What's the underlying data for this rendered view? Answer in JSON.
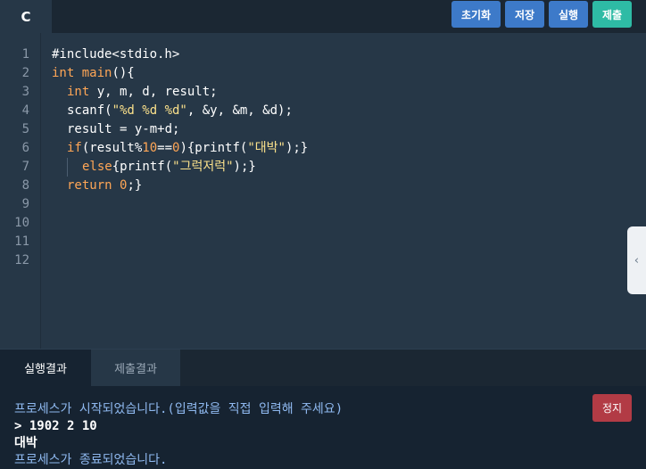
{
  "editor": {
    "language": "C",
    "line_numbers": [
      "1",
      "2",
      "3",
      "4",
      "5",
      "6",
      "7",
      "8",
      "9",
      "10",
      "11",
      "12"
    ]
  },
  "toolbar": {
    "reset_label": "초기화",
    "save_label": "저장",
    "run_label": "실행",
    "submit_label": "제출"
  },
  "code": {
    "l1": "#include<stdio.h>",
    "l2_kw": "int",
    "l2_fn": "main",
    "l2_rest": "(){",
    "l3_kw": "int",
    "l3_rest": " y, m, d, result;",
    "l4_a": "scanf(",
    "l4_str": "\"%d %d %d\"",
    "l4_b": ", &y, &m, &d);",
    "l5": "result = y-m+d;",
    "l6_kw": "if",
    "l6_a": "(result%",
    "l6_n1": "10",
    "l6_b": "==",
    "l6_n2": "0",
    "l6_c": "){printf(",
    "l6_str": "\"대박\"",
    "l6_d": ");}",
    "l7_kw": "else",
    "l7_a": "{printf(",
    "l7_str": "\"그럭저럭\"",
    "l7_b": ");}",
    "l8_kw": "return",
    "l8_n": "0",
    "l8_b": ";}"
  },
  "results": {
    "tab_run": "실행결과",
    "tab_submit": "제출결과",
    "stop_label": "정지",
    "lines": {
      "start": "프로세스가 시작되었습니다.(입력값을 직접 입력해 주세요)",
      "input": "> 1902 2 10",
      "output": "대박",
      "end": "프로세스가 종료되었습니다."
    }
  },
  "colors": {
    "bg": "#263747",
    "keyword": "#ffa656",
    "string": "#fbe18b",
    "button_blue": "#3d7ac9",
    "button_teal": "#2ebba5",
    "stop_red": "#b23b45"
  },
  "icons": {
    "side_handle": "chevron-left-icon"
  }
}
